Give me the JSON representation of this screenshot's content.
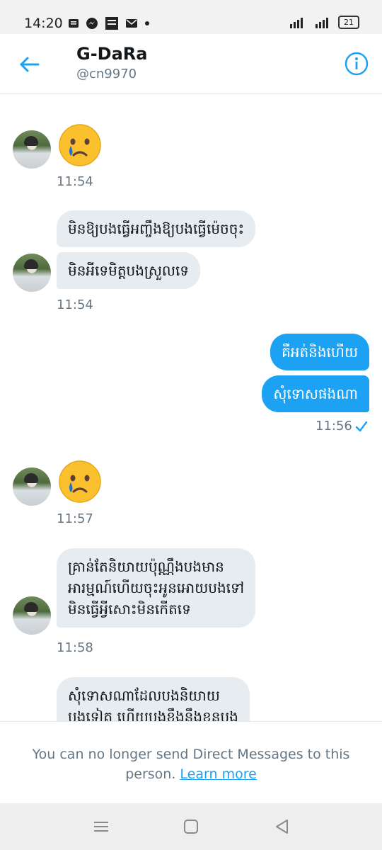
{
  "status_bar": {
    "time": "14:20",
    "battery": "21"
  },
  "header": {
    "name": "G-DaRa",
    "handle": "@cn9970"
  },
  "messages": {
    "m1": {
      "time": "11:54"
    },
    "m2": {
      "line1": "មិនឱ្យបងធ្វើអញ្ចឹងឱ្យបងធ្វើម៉េចចុះ",
      "line2": "មិនអីទេមិត្តបងស្រួលទេ",
      "time": "11:54"
    },
    "m3": {
      "line1": "គឺអត់និងហើយ",
      "line2": "សុំទោសផងណា",
      "time": "11:56"
    },
    "m4": {
      "time": "11:57"
    },
    "m5": {
      "line1": "គ្រាន់តែនិយាយប៉ុណ្ណឹងបងមាន",
      "line2": "អារម្មណ៍ហើយចុះអូនអោយបងទៅ",
      "line3": "មិនធ្វើអ្វីសោះមិនកើតទេ",
      "time": "11:58"
    },
    "m6": {
      "line1": "សុំទោសណាដែលបងនិយាយ",
      "line2": "បងទៀត ហើយបងខឹងនឹងខ្លួនបង"
    }
  },
  "footer": {
    "notice": "You can no longer send Direct Messages to this person.",
    "learn_more": "Learn more"
  },
  "colors": {
    "accent": "#1da1f2",
    "bubble_in": "#e6ecf0"
  }
}
